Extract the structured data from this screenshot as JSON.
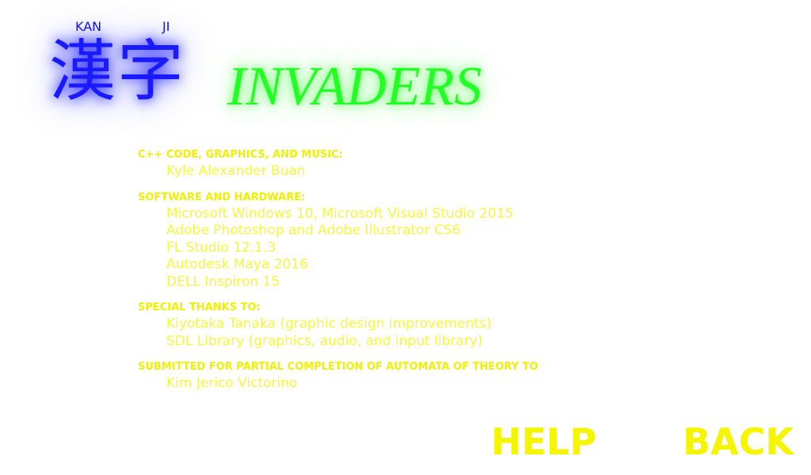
{
  "title": {
    "furigana_kan": "KAN",
    "furigana_ji": "JI",
    "kanji": "漢字",
    "invaders": "INVADERS"
  },
  "credits": {
    "sections": [
      {
        "heading": "C++ CODE, GRAPHICS, AND MUSIC:",
        "lines": [
          "Kyle Alexander Buan"
        ]
      },
      {
        "heading": "SOFTWARE AND HARDWARE:",
        "lines": [
          "Microsoft Windows 10, Microsoft Visual Studio 2015",
          "Adobe Photoshop and Adobe Illustrator CS6",
          "FL Studio 12.1.3",
          "Autodesk Maya 2016",
          "DELL Inspiron 15"
        ]
      },
      {
        "heading": "SPECIAL THANKS TO:",
        "lines": [
          "Kiyotaka Tanaka (graphic design improvements)",
          "SDL Library (graphics, audio, and input library)"
        ]
      },
      {
        "heading": "SUBMITTED FOR PARTIAL COMPLETION OF AUTOMATA OF THEORY TO",
        "lines": [
          "Kim Jerico Victorino"
        ]
      }
    ]
  },
  "menu": {
    "help_label": "HELP",
    "back_label": "BACK"
  },
  "colors": {
    "kanji": "#1a1aff",
    "invaders": "#22ff22",
    "credits_text": "#f4f416",
    "menu_text": "#f5f500",
    "background": "#ffffff"
  }
}
